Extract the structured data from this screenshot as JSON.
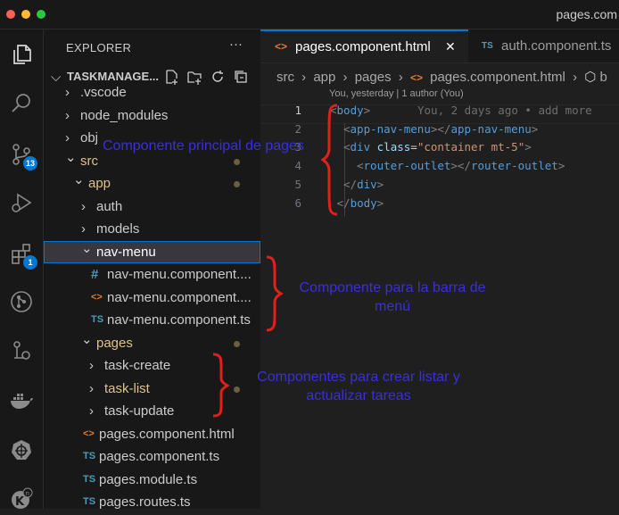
{
  "window": {
    "title": "pages.com"
  },
  "window_controls": {
    "close_color": "#ff5f57",
    "minimize_color": "#febc2e",
    "maximize_color": "#28c840"
  },
  "activity_bar": {
    "items": [
      {
        "name": "explorer-icon",
        "active": true
      },
      {
        "name": "search-icon"
      },
      {
        "name": "source-control-icon",
        "badge": "13"
      },
      {
        "name": "run-debug-icon"
      },
      {
        "name": "extensions-icon",
        "badge": "1"
      },
      {
        "name": "git-graph-icon"
      },
      {
        "name": "pull-requests-icon"
      },
      {
        "name": "docker-icon"
      },
      {
        "name": "kubernetes-icon"
      },
      {
        "name": "account-icon"
      }
    ]
  },
  "sidebar": {
    "title": "EXPLORER",
    "more": "···",
    "project": "TASKMANAGE...",
    "tree": [
      {
        "label": ".vscode",
        "kind": "folder",
        "expanded": false,
        "partial": true
      },
      {
        "label": "node_modules",
        "kind": "folder",
        "expanded": false
      },
      {
        "label": "obj",
        "kind": "folder",
        "expanded": false
      },
      {
        "label": "src",
        "kind": "folder",
        "expanded": true,
        "modified": true
      },
      {
        "label": "app",
        "kind": "folder",
        "expanded": true,
        "modified": true
      },
      {
        "label": "auth",
        "kind": "folder",
        "expanded": false
      },
      {
        "label": "models",
        "kind": "folder",
        "expanded": false
      },
      {
        "label": "nav-menu",
        "kind": "folder",
        "expanded": true,
        "selected": true
      },
      {
        "label": "nav-menu.component....",
        "kind": "file",
        "icon": "#",
        "icon_color": "#519aba"
      },
      {
        "label": "nav-menu.component....",
        "kind": "file",
        "icon": "<>",
        "icon_color": "#e37933"
      },
      {
        "label": "nav-menu.component.ts",
        "kind": "file",
        "icon": "TS",
        "icon_color": "#519aba"
      },
      {
        "label": "pages",
        "kind": "folder",
        "expanded": true,
        "modified": true
      },
      {
        "label": "task-create",
        "kind": "folder",
        "expanded": false
      },
      {
        "label": "task-list",
        "kind": "folder",
        "expanded": false,
        "modified": true
      },
      {
        "label": "task-update",
        "kind": "folder",
        "expanded": false
      },
      {
        "label": "pages.component.html",
        "kind": "file",
        "icon": "<>",
        "icon_color": "#e37933"
      },
      {
        "label": "pages.component.ts",
        "kind": "file",
        "icon": "TS",
        "icon_color": "#519aba"
      },
      {
        "label": "pages.module.ts",
        "kind": "file",
        "icon": "TS",
        "icon_color": "#519aba"
      },
      {
        "label": "pages.routes.ts",
        "kind": "file",
        "icon": "TS",
        "icon_color": "#519aba"
      }
    ]
  },
  "editor": {
    "tabs": [
      {
        "label": "pages.component.html",
        "icon": "<>",
        "active": true,
        "close": "✕"
      },
      {
        "label": "auth.component.ts",
        "icon": "TS",
        "active": false
      }
    ],
    "breadcrumb": {
      "src": "src",
      "app": "app",
      "pages": "pages",
      "file_icon": "<>",
      "file": "pages.component.html",
      "symbol": "b"
    },
    "blame": "You, yesterday | 1 author (You)",
    "ghost_blame": "You, 2 days ago • add more",
    "lines": [
      {
        "n": "1",
        "current": true,
        "text": "<body>"
      },
      {
        "n": "2",
        "text": "<app-nav-menu></app-nav-menu>"
      },
      {
        "n": "3",
        "text": "<div class=\"container mt-5\">"
      },
      {
        "n": "4",
        "text": "<router-outlet></router-outlet>"
      },
      {
        "n": "5",
        "text": "</div>"
      },
      {
        "n": "6",
        "text": "</body>"
      }
    ]
  },
  "annotations": {
    "color": "#3b2fd8",
    "brace_color": "#e0201a",
    "main": "Componente principal de pages",
    "nav_line1": "Componente para la barra de",
    "nav_line2": "menú",
    "tasks_line1": "Componentes para crear listar y",
    "tasks_line2": "actualizar tareas"
  }
}
